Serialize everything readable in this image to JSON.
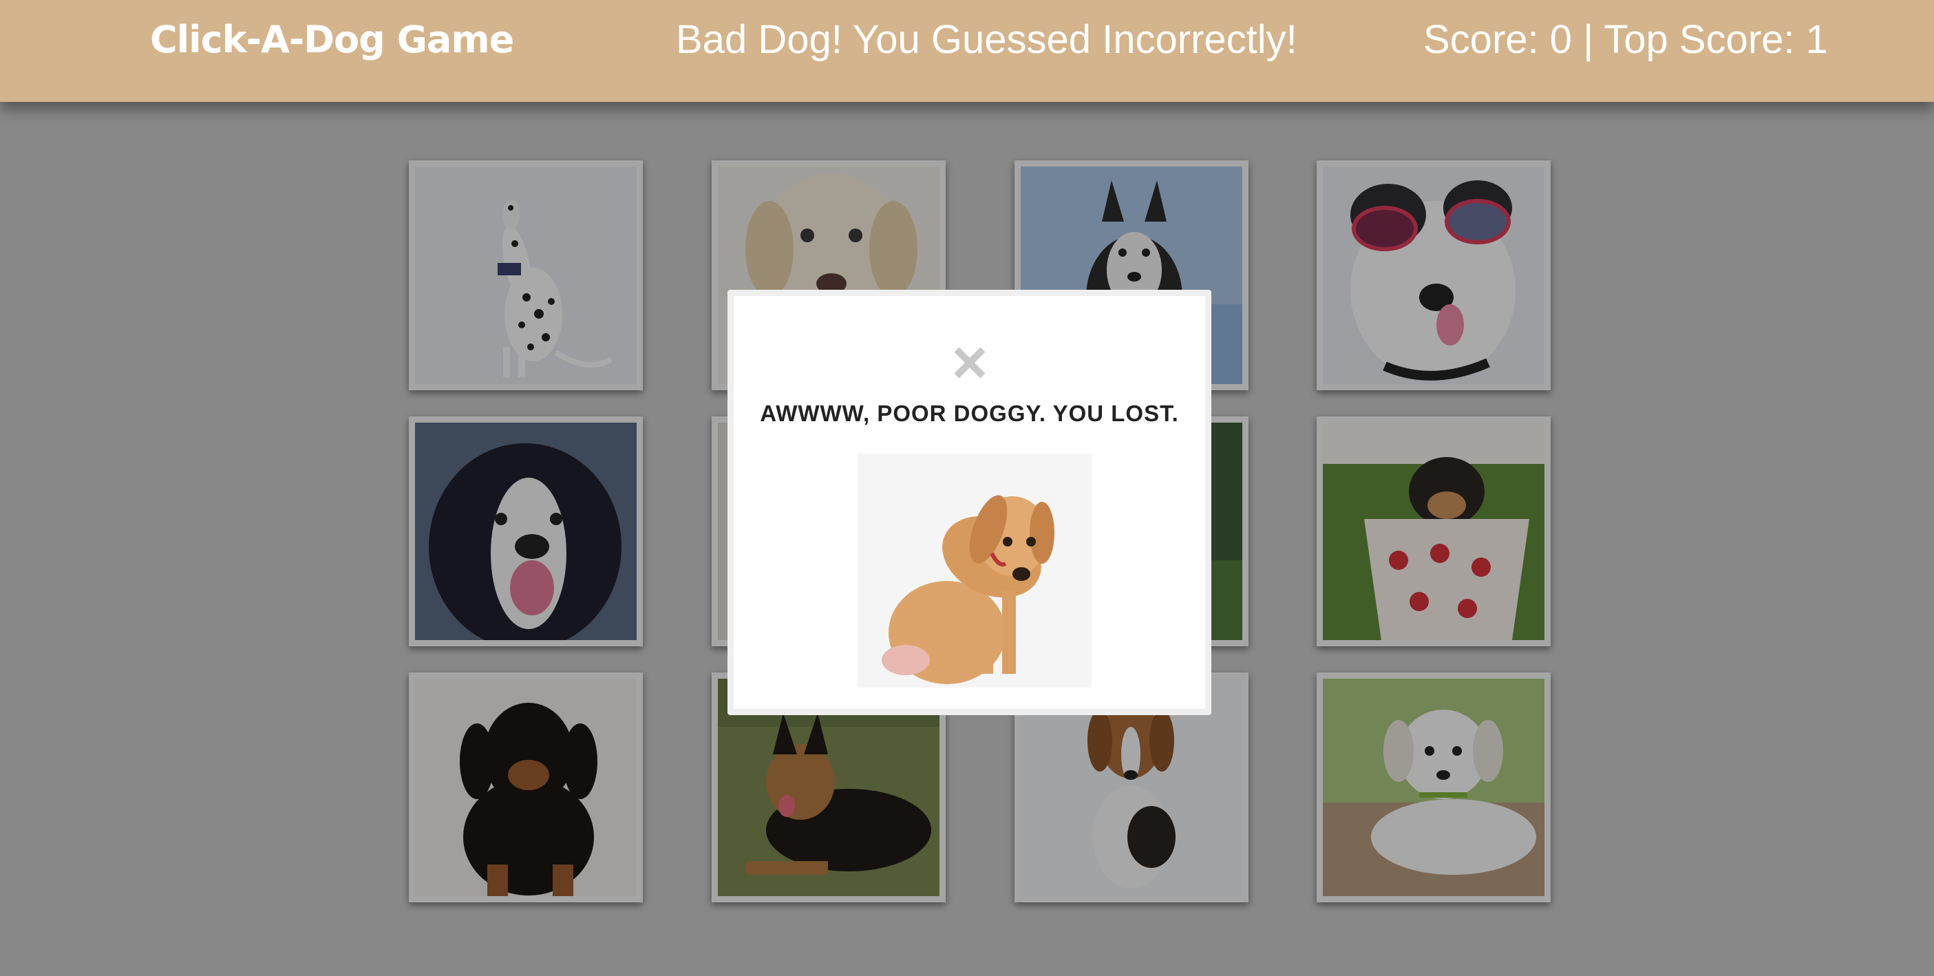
{
  "header": {
    "brand": "Click-A-Dog Game",
    "message": "Bad Dog! You Guessed Incorrectly!",
    "score_text": "Score: 0 | Top Score: 1"
  },
  "cards": [
    {
      "dog": "dalmatian"
    },
    {
      "dog": "golden retriever"
    },
    {
      "dog": "husky"
    },
    {
      "dog": "dog with sunglasses"
    },
    {
      "dog": "border collie"
    },
    {
      "dog": "hidden"
    },
    {
      "dog": "hidden"
    },
    {
      "dog": "puppy in polka dot cup"
    },
    {
      "dog": "dachshund puppy"
    },
    {
      "dog": "german shepherd"
    },
    {
      "dog": "beagle"
    },
    {
      "dog": "white puppy"
    }
  ],
  "modal": {
    "title": "AWWWW, POOR DOGGY. YOU LOST.",
    "close_icon": "close-icon"
  },
  "colors": {
    "header_bg": "#d4b48c",
    "header_text": "#ffffff",
    "page_bg": "#c9c9c9",
    "modal_bg": "#ffffff"
  }
}
